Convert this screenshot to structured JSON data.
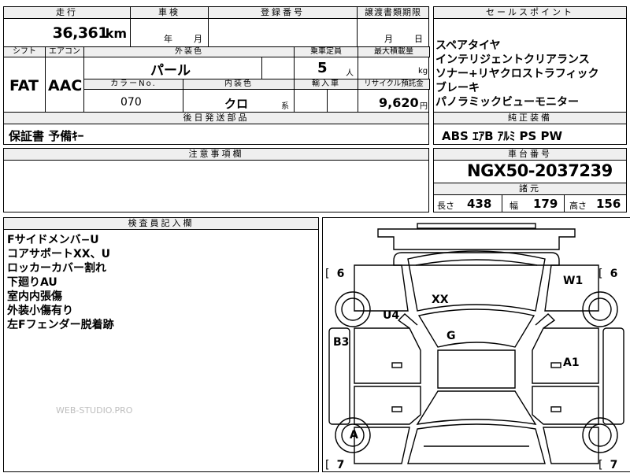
{
  "header": {
    "mileage_label": "走行",
    "inspection_label": "車検",
    "registration_label": "登録番号",
    "transfer_deadline_label": "譲渡書類期限",
    "selling_points_label": "セールスポイント"
  },
  "values": {
    "mileage": "36,361",
    "mileage_unit": "km",
    "inspection_year_unit": "年",
    "inspection_month_unit": "月",
    "transfer_month_unit": "月",
    "transfer_day_unit": "日"
  },
  "row2": {
    "shift_label": "シフト",
    "aircon_label": "エアコン",
    "exterior_label": "外装色",
    "capacity_label": "乗車定員",
    "max_load_label": "最大積載量",
    "shift": "FAT",
    "aircon": "AAC",
    "exterior_color": "パール",
    "capacity": "5",
    "capacity_unit": "人",
    "max_load_unit": "kg"
  },
  "row3": {
    "color_no_label": "カラーNo.",
    "interior_label": "内装色",
    "import_label": "輸入車",
    "recycle_label": "リサイクル預託金",
    "color_no": "070",
    "interior_color": "クロ",
    "interior_suffix": "系",
    "recycle_fee": "9,620",
    "recycle_unit": "円"
  },
  "selling_points": [
    "スペアタイヤ",
    "インテリジェントクリアランス",
    "ソナー+リヤクロストラフィック",
    "ブレーキ",
    "パノラミックビューモニター"
  ],
  "later_parts": {
    "label": "後日発送部品",
    "value": "保証書 予備ｷｰ"
  },
  "standard_equipment": {
    "label": "純正装備",
    "value": "ABS ｴｱB ｱﾙﾐ PS PW"
  },
  "notes": {
    "label": "注意事項欄"
  },
  "chassis": {
    "label": "車台番号",
    "value": "NGX50-2037239",
    "specs_label": "諸元",
    "length_label": "長さ",
    "length": "438",
    "width_label": "幅",
    "width": "179",
    "height_label": "高さ",
    "height": "156"
  },
  "inspector": {
    "label": "検査員記入欄",
    "lines": [
      "Fサイドメンバ−U",
      "コアサポートXX、U",
      "ロッカーカバー割れ",
      "下廻りAU",
      "室内内張傷",
      "外装小傷有り",
      "左Fフェンダー脱着跡"
    ],
    "watermark": "WEB-STUDIO.PRO"
  },
  "diagram": {
    "tire_fl": "6",
    "tire_fr": "6",
    "tire_rl": "7",
    "tire_rr": "7",
    "marks": {
      "xx": "XX",
      "u4": "U4",
      "w1": "W1",
      "b3": "B3",
      "g": "G",
      "a1": "A1",
      "a": "A"
    }
  }
}
